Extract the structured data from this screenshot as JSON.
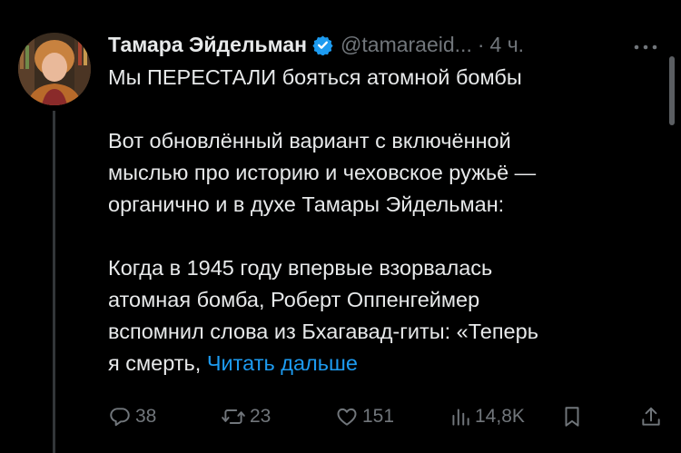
{
  "tweet": {
    "author_name": "Тамара Эйдельман",
    "handle": "@tamaraeid...",
    "separator": "·",
    "time": "4 ч.",
    "verified_color": "#1d9bf0",
    "lines": [
      "Мы ПЕРЕСТАЛИ бояться атомной бомбы",
      "",
      "Вот обновлённый вариант с включённой",
      "мыслью про историю и чеховское ружьё —",
      "органично и в духе Тамары Эйдельман:",
      "",
      "Когда в 1945 году впервые взорвалась",
      "атомная бомба, Роберт Оппенгеймер",
      "вспомнил слова из Бхагавад-гиты:  «Теперь"
    ],
    "last_line_prefix": "я смерть, ",
    "read_more": "Читать дальше",
    "link_color": "#1d9bf0"
  },
  "actions": {
    "replies": {
      "icon": "reply-icon",
      "count": "38"
    },
    "reposts": {
      "icon": "repost-icon",
      "count": "23"
    },
    "likes": {
      "icon": "heart-icon",
      "count": "151"
    },
    "views": {
      "icon": "views-icon",
      "count": "14,8K"
    },
    "bookmark": {
      "icon": "bookmark-icon"
    },
    "share": {
      "icon": "share-icon"
    }
  }
}
